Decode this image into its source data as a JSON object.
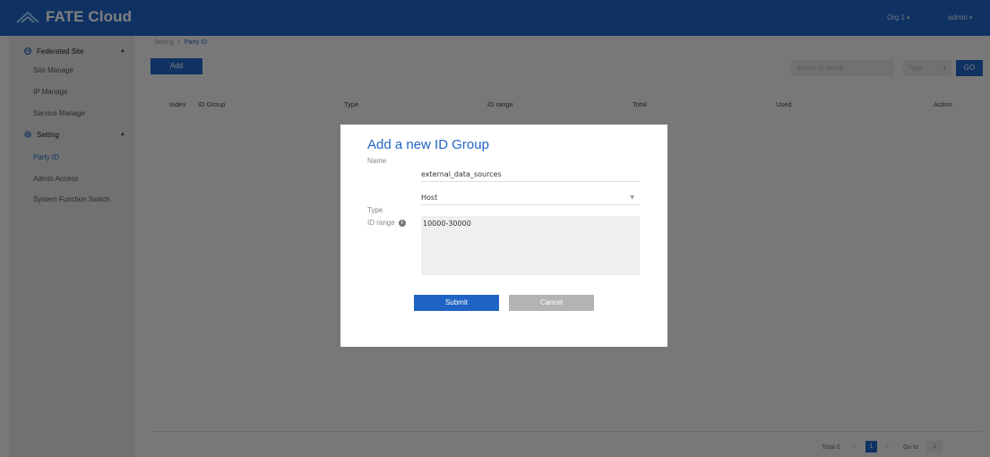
{
  "header": {
    "logo_text": "FATE Cloud",
    "org_menu": "Org 1",
    "user_menu": "admin"
  },
  "sidebar": {
    "groups": [
      {
        "label": "Federated Site",
        "icon": "globe-icon",
        "items": [
          "Site Manage",
          "IP Manage",
          "Service Manage"
        ]
      },
      {
        "label": "Setting",
        "icon": "gear-icon",
        "items": [
          "Party ID",
          "Admin Access",
          "System Function Switch"
        ]
      }
    ],
    "active_item": "Party ID"
  },
  "breadcrumb": {
    "parent": "Setting",
    "separator": ">",
    "current": "Party ID"
  },
  "toolbar": {
    "add_label": "Add",
    "search_placeholder": "Search ID Group",
    "type_placeholder": "Type",
    "go_label": "GO"
  },
  "table": {
    "columns": [
      "Index",
      "ID Group",
      "Type",
      "ID range",
      "Total",
      "Used",
      "Action"
    ]
  },
  "pagination": {
    "total_label": "Total 0",
    "prev": "<",
    "current_page": "1",
    "next": ">",
    "goto_label": "Go to",
    "goto_value": "1"
  },
  "modal": {
    "title": "Add a new ID Group",
    "name_label": "Name",
    "name_value": "external_data_sources",
    "type_label": "Type",
    "type_value": "Host",
    "range_label": "ID range",
    "range_value": "10000-30000",
    "submit_label": "Submit",
    "cancel_label": "Cancel"
  },
  "colors": {
    "brand_blue": "#1f64c4",
    "sidebar_bg": "#e3e3e3",
    "cancel_gray": "#b3b3b3"
  }
}
